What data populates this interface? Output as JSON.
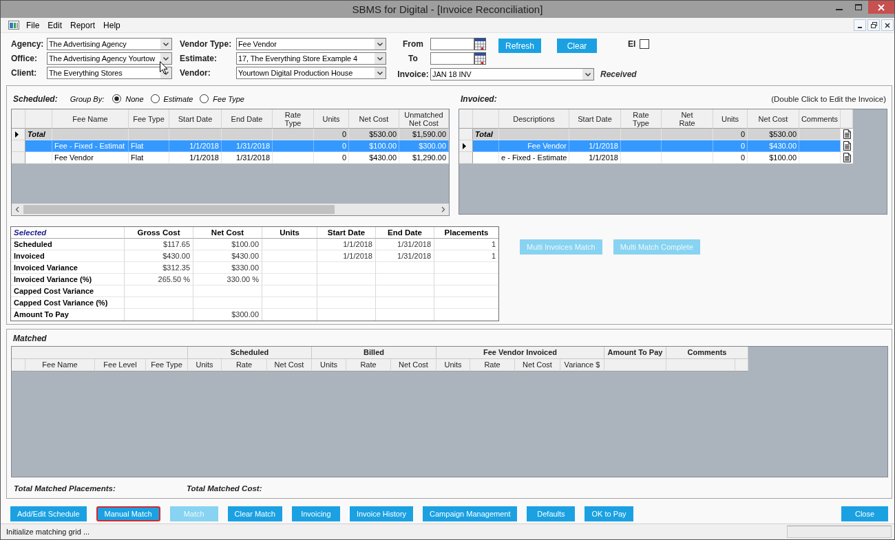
{
  "window": {
    "title": "SBMS for Digital - [Invoice Reconciliation]"
  },
  "menu": [
    "File",
    "Edit",
    "Report",
    "Help"
  ],
  "filters": {
    "left": [
      {
        "label": "Agency:",
        "value": "The Advertising Agency"
      },
      {
        "label": "Office:",
        "value": "The Advertising Agency Yourtow"
      },
      {
        "label": "Client:",
        "value": "The Everything Stores"
      }
    ],
    "middle": [
      {
        "label": "Vendor Type:",
        "value": "Fee Vendor"
      },
      {
        "label": "Estimate:",
        "value": "17, The Everything Store Example 4"
      },
      {
        "label": "Vendor:",
        "value": "Yourtown Digital Production House"
      }
    ],
    "dates": [
      {
        "label": "From"
      },
      {
        "label": "To"
      }
    ],
    "buttons": [
      "Refresh",
      "Clear"
    ],
    "ei": {
      "label": "EI",
      "checked": false
    },
    "invoice": {
      "label": "Invoice:",
      "value": "JAN 18 INV",
      "status": "Received"
    }
  },
  "scheduled": {
    "title": "Scheduled:",
    "group_by_label": "Group By:",
    "group_by": [
      {
        "label": "None",
        "selected": true
      },
      {
        "label": "Estimate",
        "selected": false
      },
      {
        "label": "Fee Type",
        "selected": false
      }
    ],
    "columns": [
      "Fee Name",
      "Fee Type",
      "Start Date",
      "End Date",
      "Rate Type",
      "Units",
      "Net Cost",
      "Unmatched Net Cost"
    ],
    "rows": [
      {
        "kind": "total",
        "label": "Total",
        "units": "0",
        "net_cost": "$530.00",
        "unmatched_net_cost": "$1,590.00",
        "current": true,
        "selected": false
      },
      {
        "kind": "item",
        "fee_name": "Fee - Fixed - Estimat",
        "fee_type": "Flat",
        "start_date": "1/1/2018",
        "end_date": "1/31/2018",
        "units": "0",
        "net_cost": "$100.00",
        "unmatched_net_cost": "$300.00",
        "current": false,
        "selected": true
      },
      {
        "kind": "item",
        "fee_name": "Fee Vendor",
        "fee_type": "Flat",
        "start_date": "1/1/2018",
        "end_date": "1/31/2018",
        "units": "0",
        "net_cost": "$430.00",
        "unmatched_net_cost": "$1,290.00",
        "current": false,
        "selected": false
      }
    ]
  },
  "invoiced": {
    "title": "Invoiced:",
    "hint": "(Double Click to Edit the Invoice)",
    "columns": [
      "Descriptions",
      "Start Date",
      "Rate Type",
      "Net Rate",
      "Units",
      "Net Cost",
      "Comments"
    ],
    "rows": [
      {
        "kind": "total",
        "label": "Total",
        "units": "0",
        "net_cost": "$530.00",
        "current": false,
        "selected": false
      },
      {
        "kind": "item",
        "description": "Fee Vendor",
        "start_date": "1/1/2018",
        "units": "0",
        "net_cost": "$430.00",
        "current": true,
        "selected": true
      },
      {
        "kind": "item",
        "description": "e - Fixed - Estimate",
        "start_date": "1/1/2018",
        "units": "0",
        "net_cost": "$100.00",
        "current": false,
        "selected": false
      }
    ]
  },
  "selected_summary": {
    "title": "Selected",
    "columns": [
      "Gross Cost",
      "Net Cost",
      "Units",
      "Start Date",
      "End Date",
      "Placements"
    ],
    "rows": [
      {
        "label": "Scheduled",
        "gross_cost": "$117.65",
        "net_cost": "$100.00",
        "start_date": "1/1/2018",
        "end_date": "1/31/2018",
        "placements": "1"
      },
      {
        "label": "Invoiced",
        "gross_cost": "$430.00",
        "net_cost": "$430.00",
        "start_date": "1/1/2018",
        "end_date": "1/31/2018",
        "placements": "1"
      },
      {
        "label": "Invoiced Variance",
        "gross_cost": "$312.35",
        "net_cost": "$330.00"
      },
      {
        "label": "Invoiced Variance (%)",
        "gross_cost": "265.50 %",
        "net_cost": "330.00 %"
      },
      {
        "label": "Capped Cost Variance"
      },
      {
        "label": "Capped Cost Variance (%)"
      },
      {
        "label": "Amount To Pay",
        "net_cost": "$300.00"
      }
    ]
  },
  "multi_buttons": [
    {
      "label": "Multi Invoices Match",
      "disabled": true
    },
    {
      "label": "Multi Match Complete",
      "disabled": true
    }
  ],
  "matched": {
    "title": "Matched",
    "groups": [
      {
        "columns": [
          "Fee Name",
          "Fee Level",
          "Fee Type"
        ]
      },
      {
        "label": "Scheduled",
        "columns": [
          "Units",
          "Rate",
          "Net Cost"
        ]
      },
      {
        "label": "Billed",
        "columns": [
          "Units",
          "Rate",
          "Net Cost"
        ]
      },
      {
        "label": "Fee Vendor Invoiced",
        "columns": [
          "Units",
          "Rate",
          "Net Cost",
          "Variance $"
        ]
      },
      {
        "label": "Amount To Pay"
      },
      {
        "label": "Comments"
      }
    ],
    "totals": [
      "Total Matched Placements:",
      "Total Matched Cost:"
    ]
  },
  "actions": [
    {
      "label": "Add/Edit Schedule",
      "disabled": false,
      "focused": false
    },
    {
      "label": "Manual Match",
      "disabled": false,
      "focused": true
    },
    {
      "label": "Match",
      "disabled": true,
      "focused": false
    },
    {
      "label": "Clear Match",
      "disabled": false,
      "focused": false
    },
    {
      "label": "Invoicing",
      "disabled": false,
      "focused": false
    },
    {
      "label": "Invoice History",
      "disabled": false,
      "focused": false
    },
    {
      "label": "Campaign Management",
      "disabled": false,
      "focused": false
    },
    {
      "label": "Defaults",
      "disabled": false,
      "focused": false
    },
    {
      "label": "OK to Pay",
      "disabled": false,
      "focused": false
    }
  ],
  "close_button": {
    "label": "Close"
  },
  "status_bar": {
    "message": "Initialize matching grid ..."
  }
}
